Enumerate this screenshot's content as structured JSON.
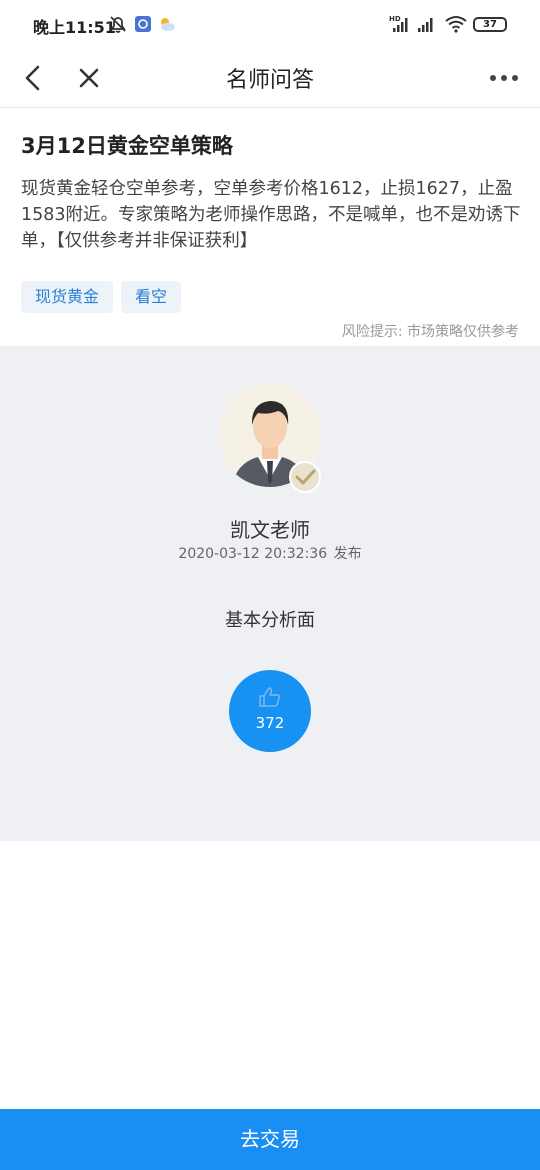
{
  "status_bar": {
    "time": "晚上11:51",
    "battery": "37",
    "icons": [
      "alarm-off-icon",
      "app-notification-icon",
      "weather-icon",
      "hd-signal-icon",
      "signal-icon",
      "wifi-icon",
      "battery-icon"
    ]
  },
  "nav": {
    "title": "名师问答",
    "back_icon": "back-chevron-icon",
    "close_icon": "close-icon",
    "more_icon": "more-icon"
  },
  "article": {
    "title": "3月12日黄金空单策略",
    "body": "现货黄金轻仓空单参考，空单参考价格1612，止损1627，止盈1583附近。专家策略为老师操作思路，不是喊单，也不是劝诱下单，【仅供参考并非保证获利】",
    "tags": [
      "现货黄金",
      "看空"
    ],
    "risk_note": "风险提示: 市场策略仅供参考"
  },
  "author": {
    "name": "凯文老师",
    "published_at": "2020-03-12 20:32:36",
    "published_suffix": "发布"
  },
  "analysis": {
    "label": "基本分析面",
    "like_count": "372"
  },
  "trade_button": {
    "label": "去交易"
  },
  "colors": {
    "accent": "#1a8ff3",
    "tag_text": "#2a7fd4",
    "tag_bg": "#eef3f9",
    "section_bg": "#eef0f4"
  }
}
